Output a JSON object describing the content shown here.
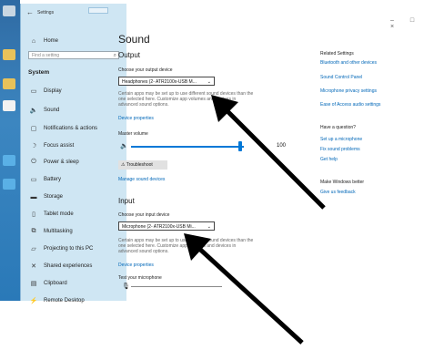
{
  "window": {
    "app_title": "Settings",
    "back_glyph": "←",
    "controls": "–  □  ×"
  },
  "sidebar": {
    "home": "Home",
    "search_placeholder": "Find a setting",
    "section": "System",
    "items": [
      {
        "label": "Display",
        "icon": "display-icon"
      },
      {
        "label": "Sound",
        "icon": "speaker-icon"
      },
      {
        "label": "Notifications & actions",
        "icon": "notifications-icon"
      },
      {
        "label": "Focus assist",
        "icon": "focus-assist-icon"
      },
      {
        "label": "Power & sleep",
        "icon": "power-icon"
      },
      {
        "label": "Battery",
        "icon": "battery-icon"
      },
      {
        "label": "Storage",
        "icon": "storage-icon"
      },
      {
        "label": "Tablet mode",
        "icon": "tablet-icon"
      },
      {
        "label": "Multitasking",
        "icon": "multitasking-icon"
      },
      {
        "label": "Projecting to this PC",
        "icon": "projecting-icon"
      },
      {
        "label": "Shared experiences",
        "icon": "shared-icon"
      },
      {
        "label": "Clipboard",
        "icon": "clipboard-icon"
      },
      {
        "label": "Remote Desktop",
        "icon": "remote-desktop-icon"
      }
    ]
  },
  "main": {
    "title": "Sound",
    "output": {
      "heading": "Output",
      "choose_label": "Choose your output device",
      "device": "Headphones (2- ATR2100x-USB M...",
      "desc": "Certain apps may be set up to use different sound devices than the one selected here. Customize app volumes and devices in advanced sound options.",
      "device_properties": "Device properties",
      "master_volume_label": "Master volume",
      "volume": "100",
      "troubleshoot": "Troubleshoot",
      "manage": "Manage sound devices"
    },
    "input": {
      "heading": "Input",
      "choose_label": "Choose your input device",
      "device": "Microphone (2- ATR2100x-USB Mi...",
      "desc": "Certain apps may be set up to use different sound devices than the one selected here. Customize app volumes and devices in advanced sound options.",
      "device_properties": "Device properties",
      "test_label": "Test your microphone"
    }
  },
  "related": {
    "heading": "Related Settings",
    "links": [
      "Bluetooth and other devices",
      "Sound Control Panel",
      "Microphone privacy settings",
      "Ease of Access audio settings"
    ],
    "question_heading": "Have a question?",
    "question_links": [
      "Set up a microphone",
      "Fix sound problems",
      "Get help"
    ],
    "better_heading": "Make Windows better",
    "better_links": [
      "Give us feedback"
    ]
  },
  "colors": {
    "accent": "#0078d7",
    "link": "#0067b8",
    "sidebar_bg": "#cfe6f3"
  }
}
